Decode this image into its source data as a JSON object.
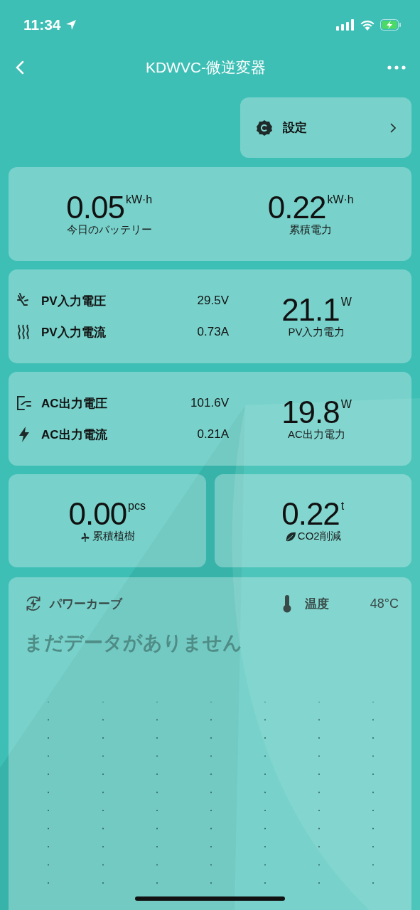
{
  "status_bar": {
    "time": "11:34"
  },
  "nav": {
    "title": "KDWVC-微逆変器"
  },
  "settings": {
    "label": "設定"
  },
  "energy": [
    {
      "value": "0.05",
      "unit": "kW·h",
      "label": "今日のバッテリー"
    },
    {
      "value": "0.22",
      "unit": "kW·h",
      "label": "累積電力"
    }
  ],
  "pv": {
    "rows": [
      {
        "kind": "voltage",
        "label": "PV入力電圧",
        "value": "29.5V"
      },
      {
        "kind": "current",
        "label": "PV入力電流",
        "value": "0.73A"
      }
    ],
    "total": {
      "value": "21.1",
      "unit": "W",
      "label": "PV入力電力"
    }
  },
  "ac": {
    "rows": [
      {
        "kind": "plug",
        "label": "AC出力電圧",
        "value": "101.6V"
      },
      {
        "kind": "bolt",
        "label": "AC出力電流",
        "value": "0.21A"
      }
    ],
    "total": {
      "value": "19.8",
      "unit": "W",
      "label": "AC出力電力"
    }
  },
  "impact": [
    {
      "kind": "tree",
      "value": "0.00",
      "unit": "pcs",
      "label": "累積植樹"
    },
    {
      "kind": "leaf",
      "value": "0.22",
      "unit": "t",
      "label": "CO2削減"
    }
  ],
  "power_curve": {
    "title": "パワーカーブ",
    "temperature_label": "温度",
    "temperature_value": "48°C",
    "empty_message": "まだデータがありません"
  }
}
